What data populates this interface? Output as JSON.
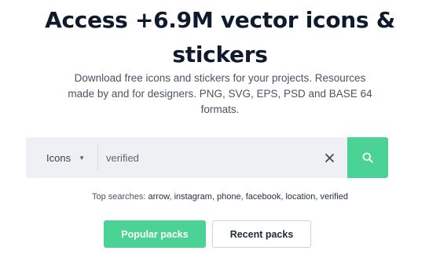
{
  "hero": {
    "title_line1": "Access +6.9M vector icons &",
    "title_line2": "stickers",
    "subtitle_line1": "Download free icons and stickers for your projects. Resources",
    "subtitle_line2": "made by and for designers. PNG, SVG, EPS, PSD and BASE 64",
    "subtitle_line3": "formats."
  },
  "search": {
    "type_selected": "Icons",
    "query": "verified",
    "icons": {
      "type_caret": "chevron-down-icon",
      "clear": "close-icon",
      "submit": "search-icon"
    },
    "colors": {
      "accent": "#4ad395",
      "field_bg": "#eef0f3"
    }
  },
  "top_searches": {
    "label": "Top searches:",
    "terms": [
      "arrow",
      "instagram",
      "phone",
      "facebook",
      "location",
      "verified"
    ]
  },
  "buttons": {
    "popular": "Popular packs",
    "recent": "Recent packs"
  }
}
